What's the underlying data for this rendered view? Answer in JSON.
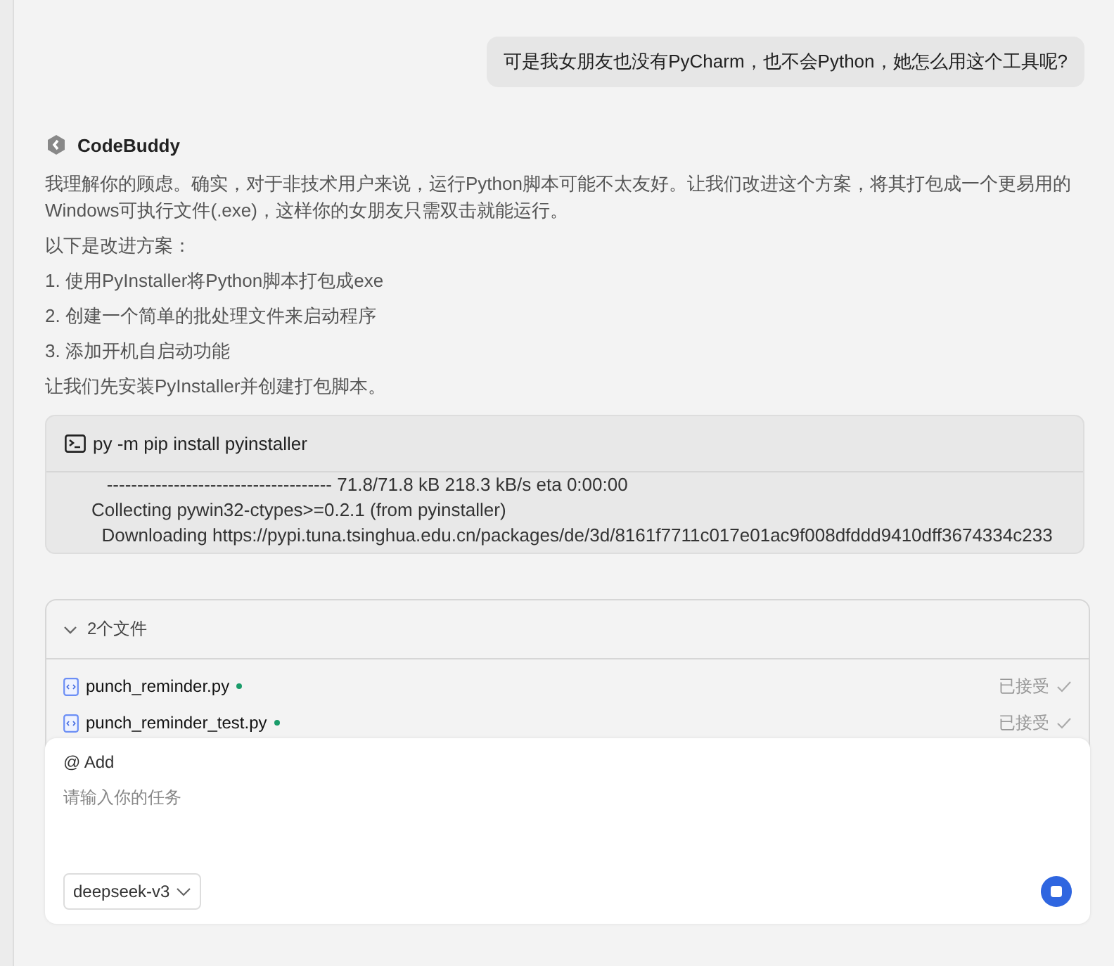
{
  "user_message": "可是我女朋友也没有PyCharm，也不会Python，她怎么用这个工具呢?",
  "assistant": {
    "name": "CodeBuddy",
    "paragraphs": [
      "我理解你的顾虑。确实，对于非技术用户来说，运行Python脚本可能不太友好。让我们改进这个方案，将其打包成一个更易用的Windows可执行文件(.exe)，这样你的女朋友只需双击就能运行。",
      "以下是改进方案：",
      "1. 使用PyInstaller将Python脚本打包成exe",
      "2. 创建一个简单的批处理文件来启动程序",
      "3. 添加开机自启动功能",
      "让我们先安装PyInstaller并创建打包脚本。"
    ]
  },
  "terminal": {
    "command": "py -m pip install pyinstaller",
    "output": [
      "   ------------------------------------- 71.8/71.8 kB 218.3 kB/s eta 0:00:00",
      "Collecting pywin32-ctypes>=0.2.1 (from pyinstaller)",
      "  Downloading https://pypi.tuna.tsinghua.edu.cn/packages/de/3d/8161f7711c017e01ac9f008dfddd9410dff3674334c233"
    ]
  },
  "files_panel": {
    "title": "2个文件",
    "expanded": true,
    "files": [
      {
        "name": "punch_reminder.py",
        "modified": true,
        "status": "已接受"
      },
      {
        "name": "punch_reminder_test.py",
        "modified": true,
        "status": "已接受"
      }
    ]
  },
  "composer": {
    "mention": "@ Add",
    "placeholder": "请输入你的任务",
    "model": "deepseek-v3"
  }
}
